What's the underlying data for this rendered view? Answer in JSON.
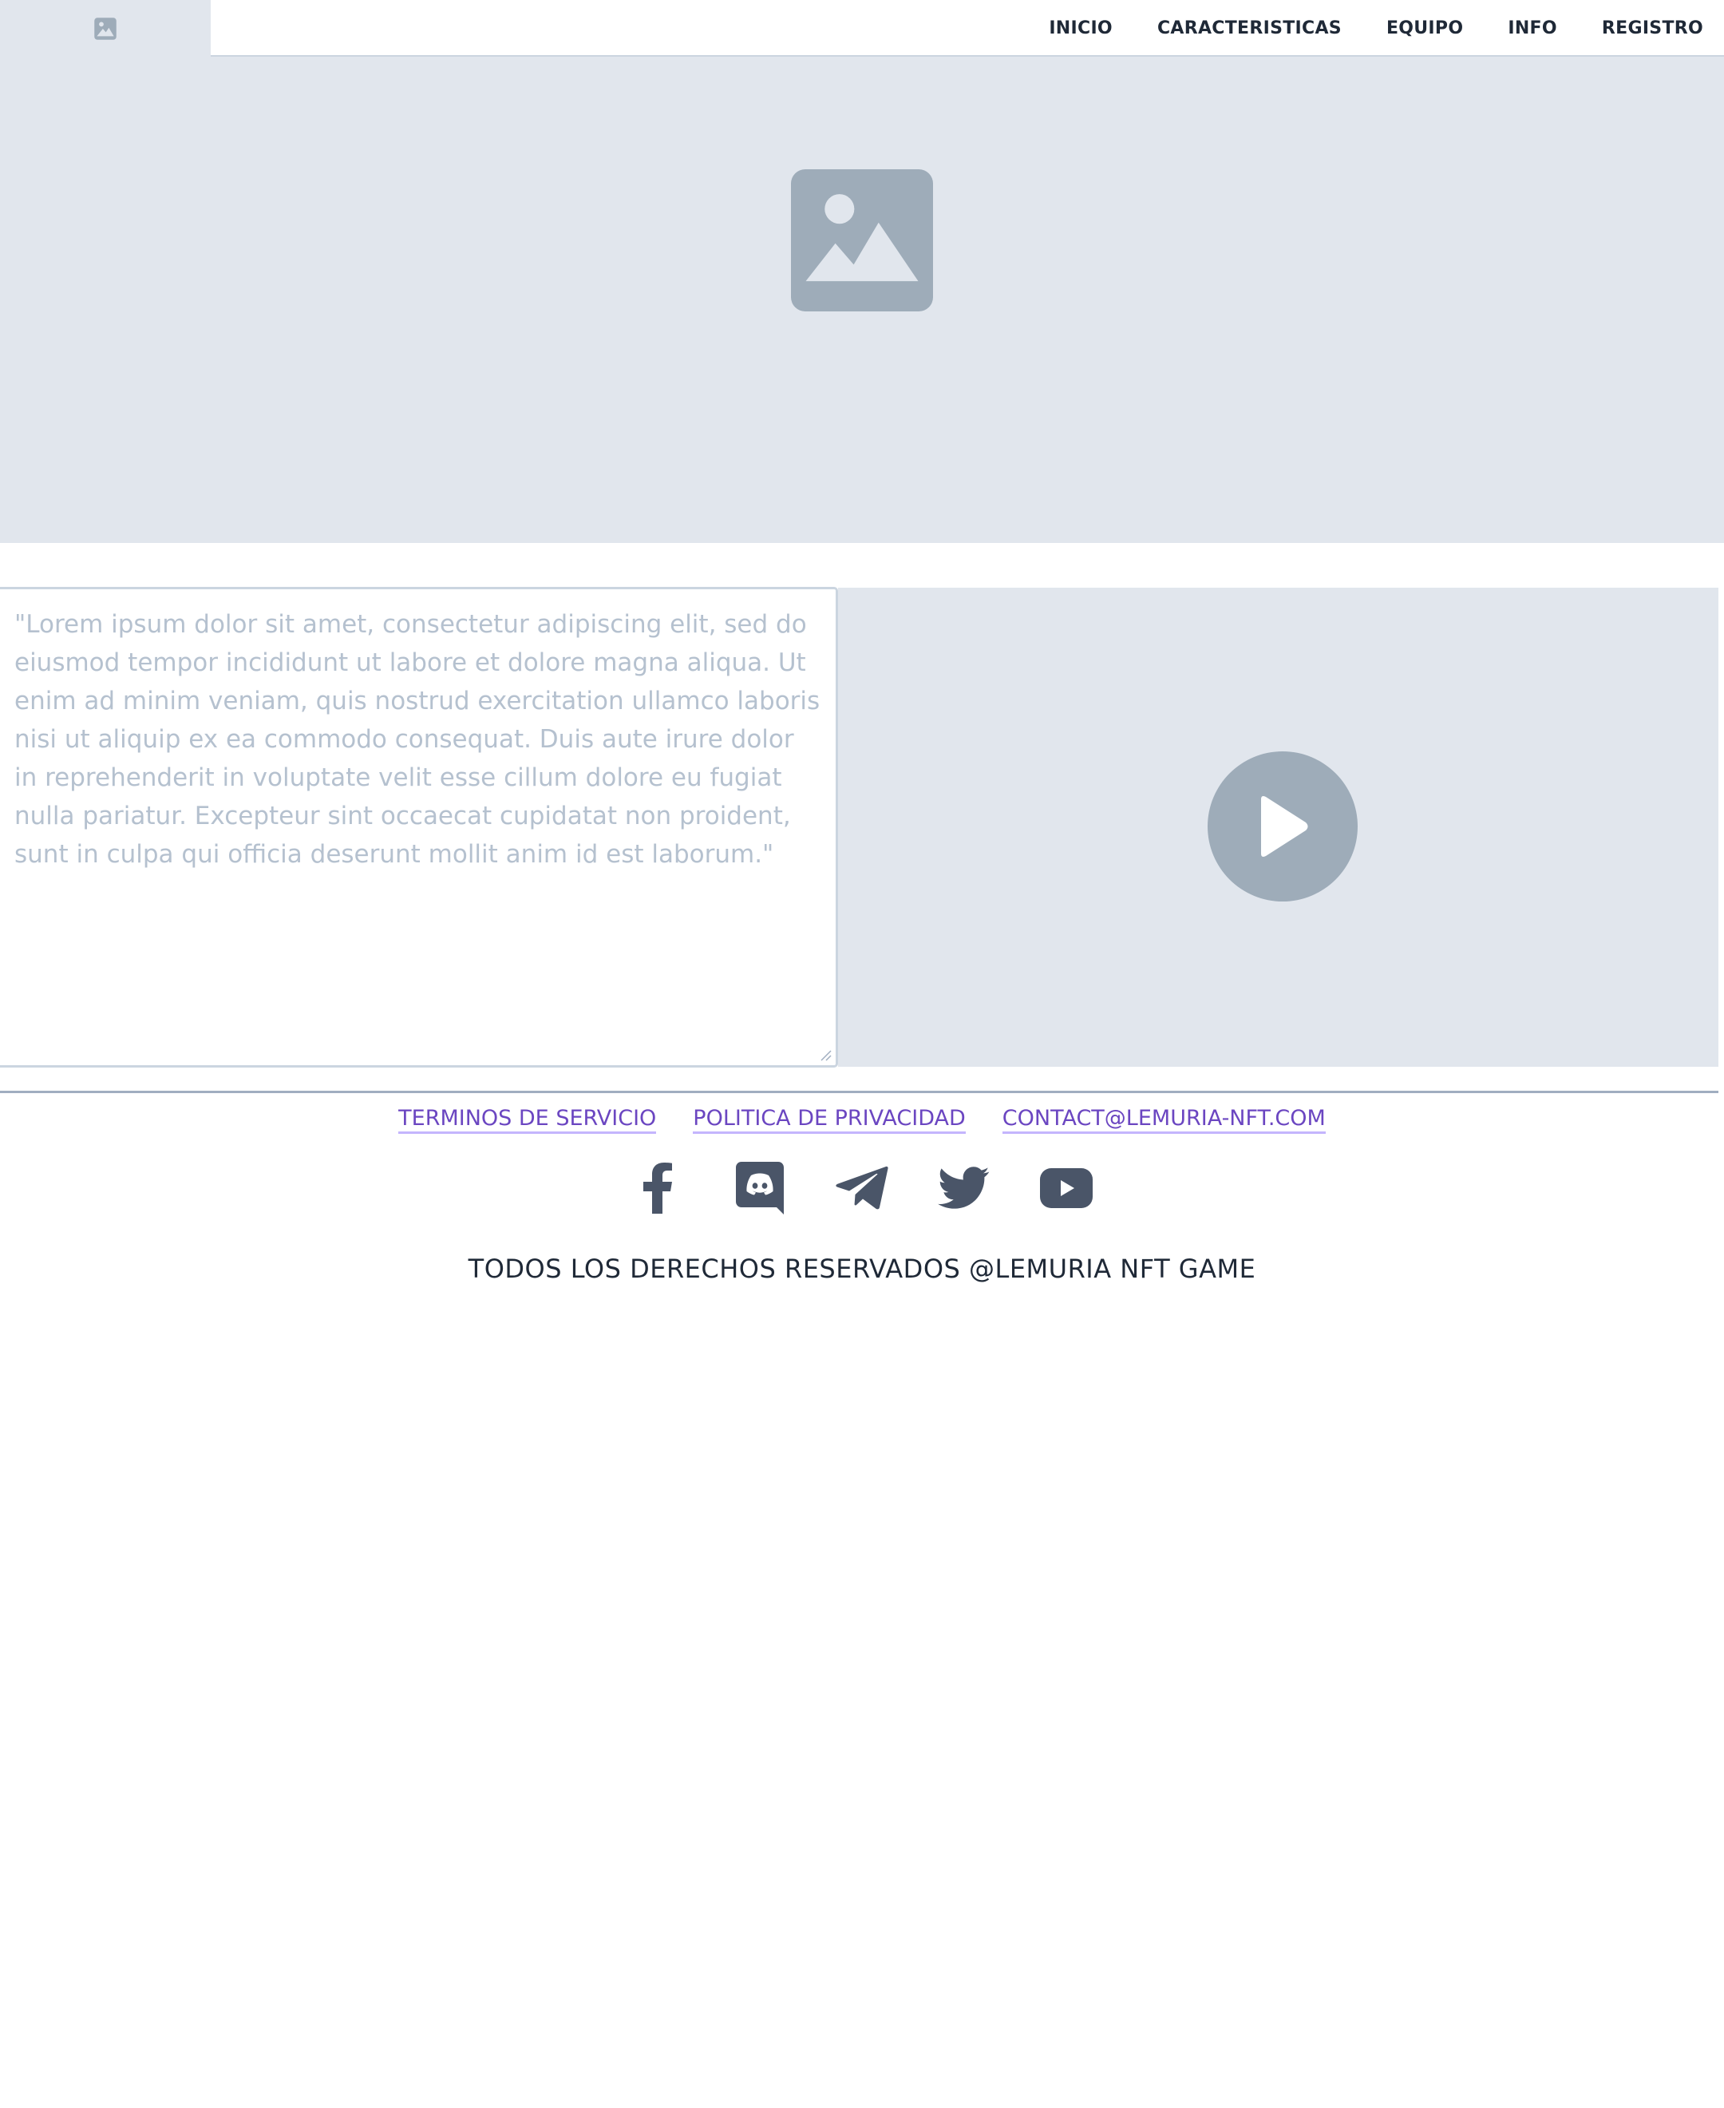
{
  "header": {
    "logo_icon": "image-placeholder-icon",
    "nav": [
      {
        "label": "INICIO"
      },
      {
        "label": "CARACTERISTICAS"
      },
      {
        "label": "EQUIPO"
      },
      {
        "label": "INFO"
      },
      {
        "label": "REGISTRO"
      }
    ]
  },
  "hero": {
    "icon": "image-placeholder-icon"
  },
  "content": {
    "text": "\"Lorem ipsum dolor sit amet, consectetur adipiscing elit, sed do eiusmod tempor incididunt ut labore et dolore magna aliqua. Ut enim ad minim veniam, quis nostrud exercitation ullamco laboris nisi ut aliquip ex ea commodo consequat. Duis aute irure dolor in reprehenderit in voluptate velit esse cillum dolore eu fugiat nulla pariatur. Excepteur sint occaecat cupidatat non proident, sunt in culpa qui officia deserunt mollit anim id est laborum.\"",
    "video_icon": "play-icon"
  },
  "footer": {
    "links": [
      {
        "label": "TERMINOS DE SERVICIO"
      },
      {
        "label": "POLITICA DE PRIVACIDAD"
      },
      {
        "label": "CONTACT@LEMURIA-NFT.COM"
      }
    ],
    "social": [
      "facebook-icon",
      "discord-icon",
      "telegram-icon",
      "twitter-icon",
      "youtube-icon"
    ],
    "copyright": "TODOS LOS DERECHOS RESERVADOS @LEMURIA NFT GAME"
  },
  "colors": {
    "placeholder_bg": "#e1e6ed",
    "placeholder_icon": "#9eacb9",
    "nav_text": "#1f2937",
    "link": "#6b46c1",
    "muted_text": "#b5c1cf",
    "social_icon": "#4a5568"
  }
}
